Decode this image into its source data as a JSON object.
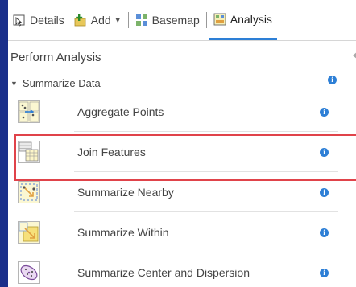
{
  "toolbar": {
    "details_label": "Details",
    "add_label": "Add",
    "basemap_label": "Basemap",
    "analysis_label": "Analysis"
  },
  "panel": {
    "title": "Perform Analysis",
    "section_label": "Summarize Data",
    "tools": [
      {
        "label": "Aggregate Points"
      },
      {
        "label": "Join Features"
      },
      {
        "label": "Summarize Nearby"
      },
      {
        "label": "Summarize Within"
      },
      {
        "label": "Summarize Center and Dispersion"
      }
    ],
    "info_glyph": "i"
  },
  "colors": {
    "accent": "#2d7fd6",
    "highlight": "#e0434a",
    "background": "#1a2f8a"
  }
}
